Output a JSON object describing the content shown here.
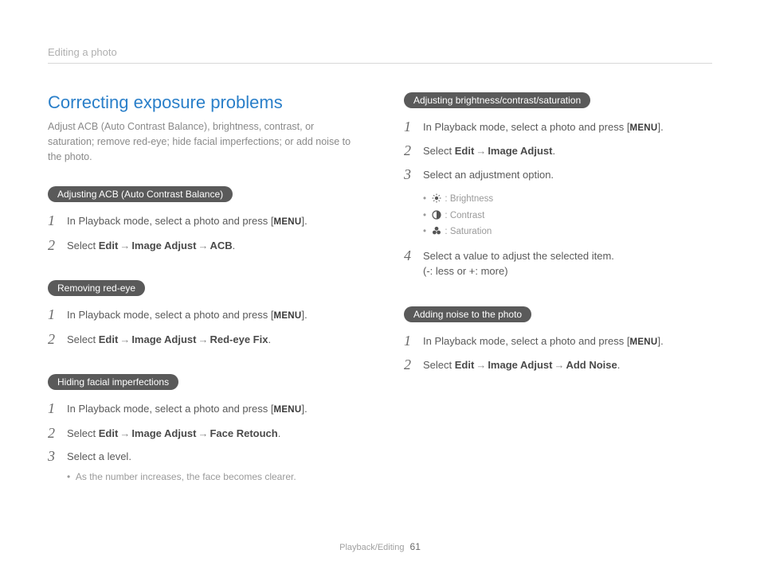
{
  "header": {
    "breadcrumb": "Editing a photo"
  },
  "title": "Correcting exposure problems",
  "intro": "Adjust ACB (Auto Contrast Balance), brightness, contrast, or saturation; remove red-eye; hide facial imperfections; or add noise to the photo.",
  "menu_label": "MENU",
  "arrow": "→",
  "labels": {
    "edit": "Edit",
    "image_adjust": "Image Adjust",
    "acb": "ACB",
    "redeye": "Red-eye Fix",
    "face_retouch": "Face Retouch",
    "add_noise": "Add Noise"
  },
  "steps": {
    "playback_prefix": "In Playback mode, select a photo and press [",
    "playback_suffix": "].",
    "select_prefix": "Select ",
    "select_level": "Select a level.",
    "select_adjust_option": "Select an adjustment option.",
    "select_value": "Select a value to adjust the selected item.",
    "value_hint": "(-: less or +: more)"
  },
  "blocks": {
    "acb": {
      "pill": "Adjusting ACB (Auto Contrast Balance)"
    },
    "redeye": {
      "pill": "Removing red-eye"
    },
    "face": {
      "pill": "Hiding facial imperfections",
      "note": "As the number increases, the face becomes clearer."
    },
    "bcs": {
      "pill": "Adjusting brightness/contrast/saturation",
      "options": {
        "brightness": "Brightness",
        "contrast": "Contrast",
        "saturation": "Saturation"
      }
    },
    "noise": {
      "pill": "Adding noise to the photo"
    }
  },
  "footer": {
    "section": "Playback/Editing",
    "page": "61"
  }
}
